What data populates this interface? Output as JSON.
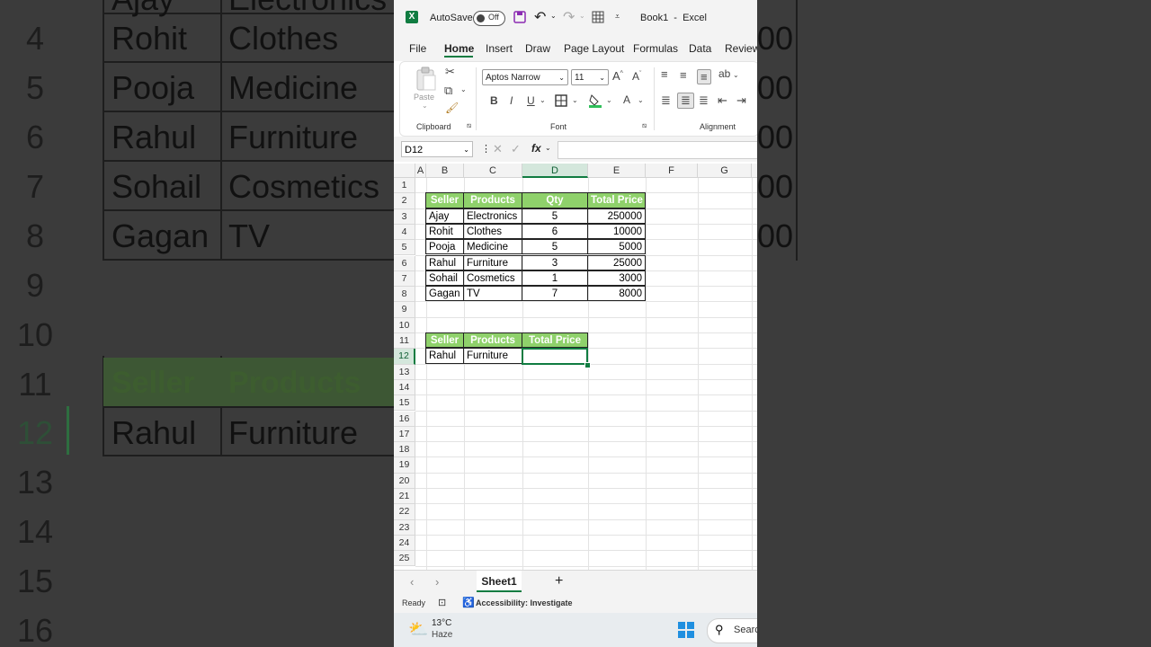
{
  "background": {
    "rows": [
      {
        "num": "4",
        "seller": "Rohit",
        "product": "Clothes"
      },
      {
        "num": "5",
        "seller": "Pooja",
        "product": "Medicine"
      },
      {
        "num": "6",
        "seller": "Rahul",
        "product": "Furniture"
      },
      {
        "num": "7",
        "seller": "Sohail",
        "product": "Cosmetics"
      },
      {
        "num": "8",
        "seller": "Gagan",
        "product": "TV"
      }
    ],
    "empty_rows": [
      "9",
      "10"
    ],
    "header_row": {
      "num": "11",
      "seller": "Seller",
      "product": "Products"
    },
    "data_row": {
      "num": "12",
      "seller": "Rahul",
      "product": "Furniture"
    },
    "trailing_rows": [
      "13",
      "14",
      "15",
      "16"
    ],
    "top_partial_seller": "Ajay",
    "top_partial_product": "Electronics",
    "right_fragment": "00"
  },
  "titlebar": {
    "autosave_label": "AutoSave",
    "toggle_state": "Off",
    "title": "Book1  -  Excel"
  },
  "ribbon_tabs": [
    "File",
    "Home",
    "Insert",
    "Draw",
    "Page Layout",
    "Formulas",
    "Data",
    "Review"
  ],
  "ribbon": {
    "paste_label": "Paste",
    "font_name": "Aptos Narrow",
    "font_size": "11",
    "groups": {
      "clipboard": "Clipboard",
      "font": "Font",
      "alignment": "Alignment"
    }
  },
  "formula_bar": {
    "name_box": "D12",
    "fx": "fx",
    "value": ""
  },
  "grid": {
    "columns": [
      "A",
      "B",
      "C",
      "D",
      "E",
      "F",
      "G"
    ],
    "selected_column": "D",
    "rows": [
      "1",
      "2",
      "3",
      "4",
      "5",
      "6",
      "7",
      "8",
      "9",
      "10",
      "11",
      "12",
      "13",
      "14",
      "15",
      "16",
      "17",
      "18",
      "19",
      "20",
      "21",
      "22",
      "23",
      "24",
      "25"
    ],
    "selected_row": "12",
    "table1": {
      "headers": [
        "Seller",
        "Products",
        "Qty",
        "Total Price"
      ],
      "rows": [
        [
          "Ajay",
          "Electronics",
          "5",
          "250000"
        ],
        [
          "Rohit",
          "Clothes",
          "6",
          "10000"
        ],
        [
          "Pooja",
          "Medicine",
          "5",
          "5000"
        ],
        [
          "Rahul",
          "Furniture",
          "3",
          "25000"
        ],
        [
          "Sohail",
          "Cosmetics",
          "1",
          "3000"
        ],
        [
          "Gagan",
          "TV",
          "7",
          "8000"
        ]
      ]
    },
    "table2": {
      "headers": [
        "Seller",
        "Products",
        "Total Price"
      ],
      "row": [
        "Rahul",
        "Furniture",
        ""
      ]
    }
  },
  "sheet_tabs": [
    "Sheet1"
  ],
  "status": {
    "ready": "Ready",
    "accessibility": "Accessibility: Investigate"
  },
  "taskbar": {
    "temperature": "13°C",
    "weather": "Haze",
    "search_label": "Searc"
  }
}
